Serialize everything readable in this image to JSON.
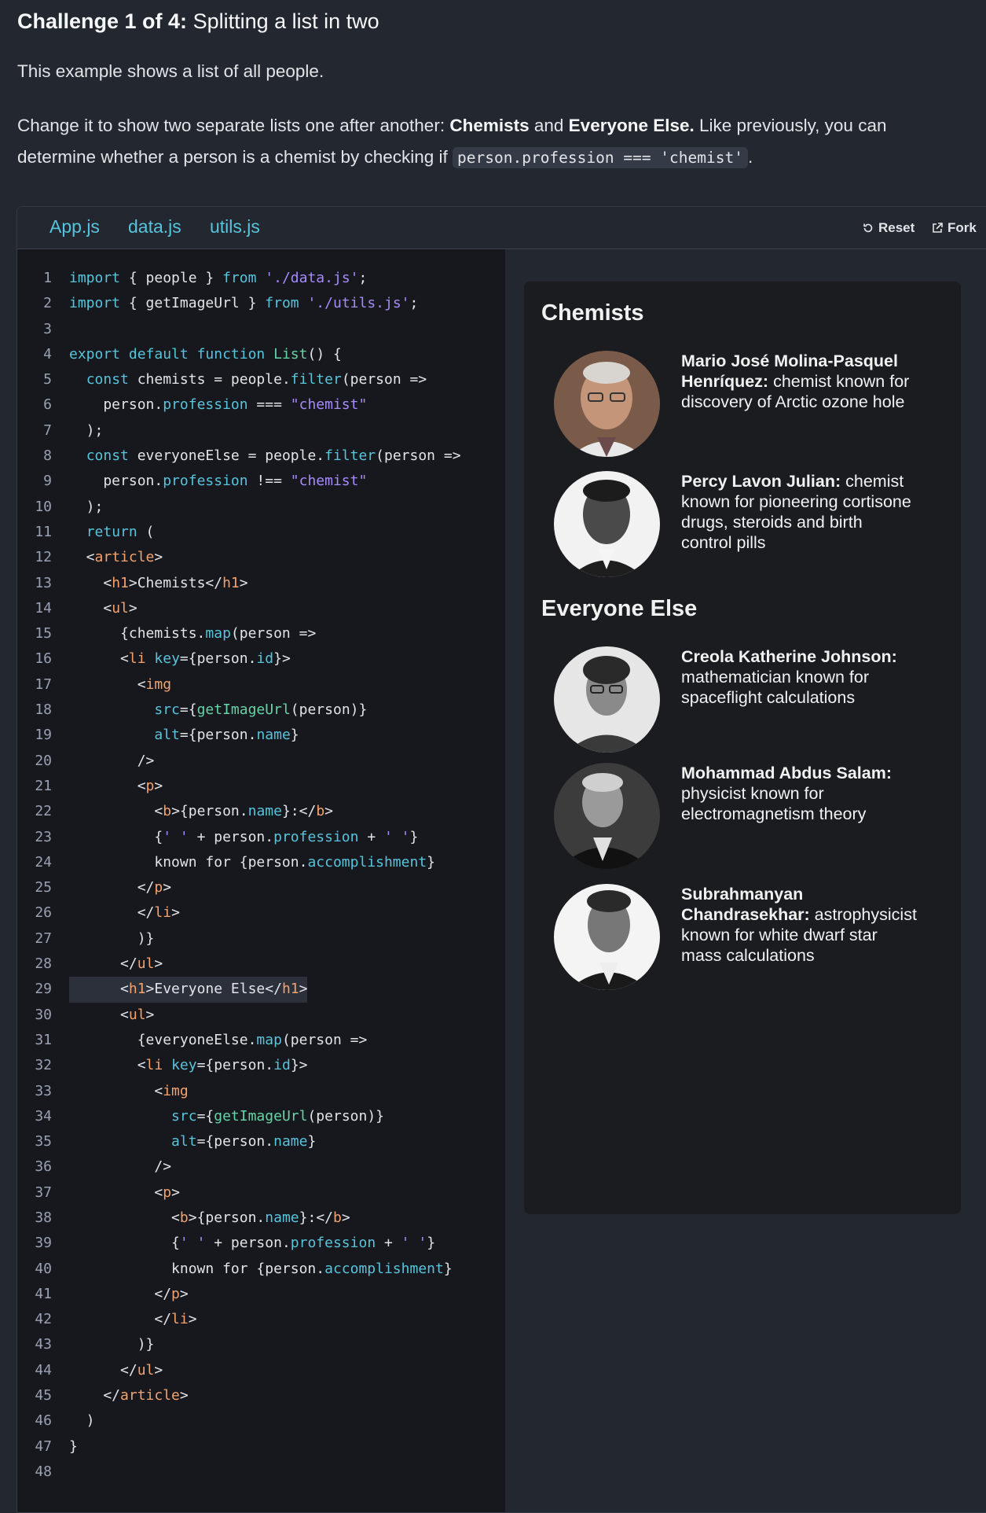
{
  "header": {
    "challenge_label": "Challenge 1 of 4:",
    "challenge_title": "Splitting a list in two",
    "intro": "This example shows a list of all people.",
    "desc_part1": "Change it to show two separate lists one after another: ",
    "desc_bold1": "Chemists",
    "desc_part2": " and ",
    "desc_bold2": "Everyone Else.",
    "desc_part3": " Like previously, you can determine whether a person is a chemist by checking if ",
    "desc_code": "person.profession === 'chemist'",
    "desc_part4": "."
  },
  "tabs": [
    {
      "label": "App.js"
    },
    {
      "label": "data.js"
    },
    {
      "label": "utils.js"
    }
  ],
  "toolbar": {
    "reset_label": "Reset",
    "fork_label": "Fork"
  },
  "preview": {
    "section1_title": "Chemists",
    "section2_title": "Everyone Else",
    "people": [
      {
        "name": "Mario José Molina-Pasquel Henríquez:",
        "desc": " chemist known for discovery of Arctic ozone hole",
        "image": "portrait-photo"
      },
      {
        "name": "Percy Lavon Julian:",
        "desc": " chemist known for pioneering cortisone drugs, steroids and birth control pills",
        "image": "portrait-photo"
      },
      {
        "name": "Creola Katherine Johnson:",
        "desc": " mathematician known for spaceflight calculations",
        "image": "portrait-photo"
      },
      {
        "name": "Mohammad Abdus Salam:",
        "desc": " physicist known for electromagnetism theory",
        "image": "portrait-photo"
      },
      {
        "name": "Subrahmanyan Chandrasekhar:",
        "desc": " astrophysicist known for white dwarf star mass calculations",
        "image": "portrait-photo"
      }
    ]
  },
  "code_lines": [
    "import { people } from './data.js';",
    "import { getImageUrl } from './utils.js';",
    "",
    "export default function List() {",
    "  const chemists = people.filter(person =>",
    "    person.profession === \"chemist\"",
    "  );",
    "  const everyoneElse = people.filter(person =>",
    "    person.profession !== \"chemist\"",
    "  );",
    "  return (",
    "  <article>",
    "    <h1>Chemists</h1>",
    "    <ul>",
    "      {chemists.map(person =>",
    "      <li key={person.id}>",
    "        <img",
    "          src={getImageUrl(person)}",
    "          alt={person.name}",
    "        />",
    "        <p>",
    "          <b>{person.name}:</b>",
    "          {' ' + person.profession + ' '}",
    "          known for {person.accomplishment}",
    "        </p>",
    "        </li>",
    "        )}",
    "      </ul>",
    "      <h1>Everyone Else</h1>",
    "      <ul>",
    "        {everyoneElse.map(person =>",
    "        <li key={person.id}>",
    "          <img",
    "            src={getImageUrl(person)}",
    "            alt={person.name}",
    "          />",
    "          <p>",
    "            <b>{person.name}:</b>",
    "            {' ' + person.profession + ' '}",
    "            known for {person.accomplishment}",
    "          </p>",
    "          </li>",
    "        )}",
    "      </ul>",
    "    </article>",
    "  )",
    "}",
    ""
  ]
}
